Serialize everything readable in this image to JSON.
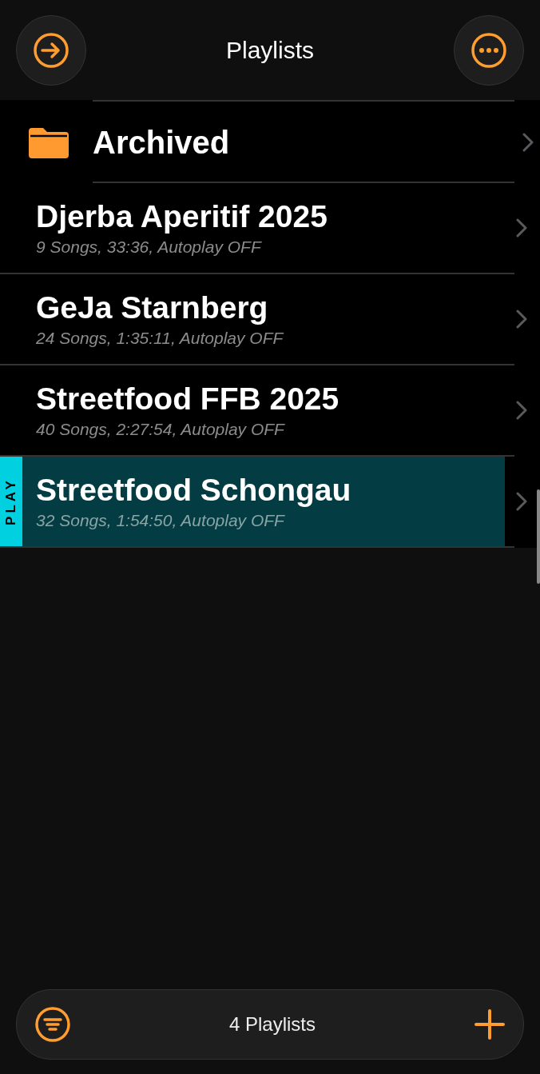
{
  "header": {
    "title": "Playlists"
  },
  "folder": {
    "label": "Archived"
  },
  "playlists": [
    {
      "name": "Djerba Aperitif 2025",
      "details": "9 Songs, 33:36, Autoplay OFF",
      "playing": false
    },
    {
      "name": "GeJa Starnberg",
      "details": "24 Songs, 1:35:11, Autoplay OFF",
      "playing": false
    },
    {
      "name": "Streetfood FFB 2025",
      "details": "40 Songs, 2:27:54, Autoplay OFF",
      "playing": false
    },
    {
      "name": "Streetfood Schongau",
      "details": "32 Songs, 1:54:50, Autoplay OFF",
      "playing": true,
      "badge": "PLAY"
    }
  ],
  "footer": {
    "count": "4 Playlists"
  }
}
